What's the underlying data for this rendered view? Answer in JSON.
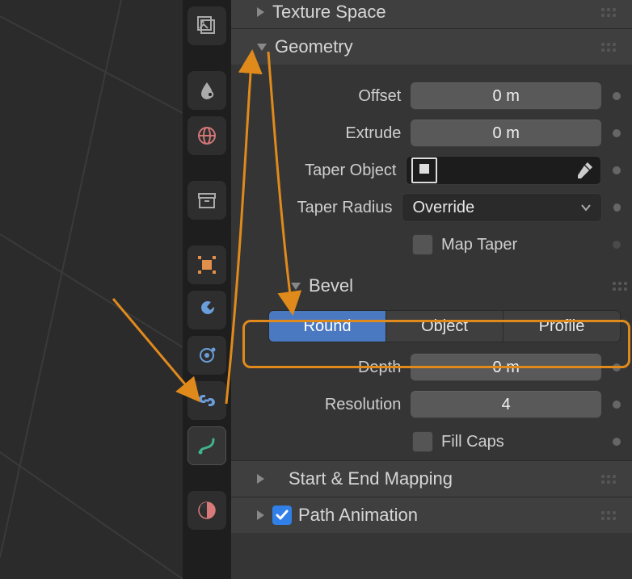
{
  "texture_space": {
    "label": "Texture Space"
  },
  "geometry": {
    "label": "Geometry"
  },
  "offset": {
    "label": "Offset",
    "value": "0 m"
  },
  "extrude": {
    "label": "Extrude",
    "value": "0 m"
  },
  "taper_object": {
    "label": "Taper Object"
  },
  "taper_radius": {
    "label": "Taper Radius",
    "value": "Override"
  },
  "map_taper": {
    "label": "Map Taper"
  },
  "bevel": {
    "label": "Bevel"
  },
  "bevel_mode": {
    "round": "Round",
    "object": "Object",
    "profile": "Profile"
  },
  "depth": {
    "label": "Depth",
    "value": "0 m"
  },
  "resolution": {
    "label": "Resolution",
    "value": "4"
  },
  "fill_caps": {
    "label": "Fill Caps"
  },
  "start_end": {
    "label": "Start & End Mapping"
  },
  "path_anim": {
    "label": "Path Animation"
  },
  "icons": {
    "image": "image-data-icon",
    "fluid": "fluid-icon",
    "world": "world-icon",
    "archive": "archive-icon",
    "object": "object-icon",
    "wrench": "wrench-icon",
    "constraint": "constraint-icon",
    "lattice": "lattice-icon",
    "curve": "curve-data-icon",
    "material": "material-icon"
  }
}
